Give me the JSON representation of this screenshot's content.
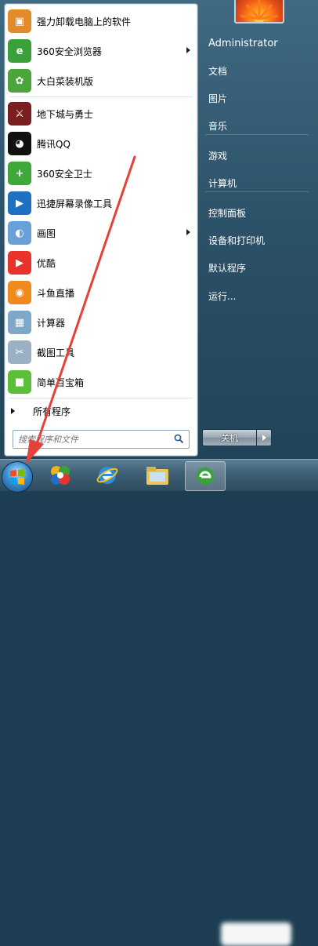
{
  "programs": [
    {
      "label": "强力卸载电脑上的软件",
      "icon": "uninstall-box-icon",
      "color": "#e38a2a",
      "arrow": false
    },
    {
      "label": "360安全浏览器",
      "icon": "360-browser-icon",
      "color": "#3aa13a",
      "arrow": true
    },
    {
      "label": "大白菜装机版",
      "icon": "cabbage-icon",
      "color": "#4aa53a",
      "arrow": false
    },
    {
      "label": "地下城与勇士",
      "icon": "dnf-game-icon",
      "color": "#7a1f1f",
      "arrow": false
    },
    {
      "label": "腾讯QQ",
      "icon": "qq-penguin-icon",
      "color": "#111111",
      "arrow": false
    },
    {
      "label": "360安全卫士",
      "icon": "360-safeguard-icon",
      "color": "#3ea83a",
      "arrow": false
    },
    {
      "label": "迅捷屏幕录像工具",
      "icon": "screen-recorder-icon",
      "color": "#1f6fc2",
      "arrow": false
    },
    {
      "label": "画图",
      "icon": "paint-palette-icon",
      "color": "#6aa0d8",
      "arrow": true
    },
    {
      "label": "优酷",
      "icon": "youku-play-icon",
      "color": "#e8322a",
      "arrow": false
    },
    {
      "label": "斗鱼直播",
      "icon": "douyu-icon",
      "color": "#f08a1e",
      "arrow": false
    },
    {
      "label": "计算器",
      "icon": "calculator-icon",
      "color": "#7fa7c7",
      "arrow": false
    },
    {
      "label": "截图工具",
      "icon": "scissors-icon",
      "color": "#9ab0c4",
      "arrow": false
    },
    {
      "label": "简单百宝箱",
      "icon": "treasure-box-icon",
      "color": "#5bbf3a",
      "arrow": false
    }
  ],
  "all_programs_label": "所有程序",
  "search": {
    "placeholder": "搜索程序和文件"
  },
  "right_items": [
    {
      "label": "Administrator",
      "name": "right-item-administrator"
    },
    {
      "label": "文档",
      "name": "right-item-documents"
    },
    {
      "label": "图片",
      "name": "right-item-pictures"
    },
    {
      "label": "音乐",
      "name": "right-item-music"
    },
    {
      "label": "游戏",
      "name": "right-item-games"
    },
    {
      "label": "计算机",
      "name": "right-item-computer"
    },
    {
      "label": "控制面板",
      "name": "right-item-control-panel"
    },
    {
      "label": "设备和打印机",
      "name": "right-item-devices-printers"
    },
    {
      "label": "默认程序",
      "name": "right-item-default-programs"
    },
    {
      "label": "运行...",
      "name": "right-item-run"
    }
  ],
  "shutdown_label": "关机",
  "taskbar": {
    "pinned": [
      {
        "icon": "360-colorful-icon"
      },
      {
        "icon": "ie-browser-icon"
      },
      {
        "icon": "file-explorer-icon"
      },
      {
        "icon": "360-browser-taskbar-icon"
      }
    ]
  },
  "colors": {
    "annotation_arrow": "#e3413a",
    "menu_bg": "#2f5770",
    "accent": "#1d3e52"
  }
}
